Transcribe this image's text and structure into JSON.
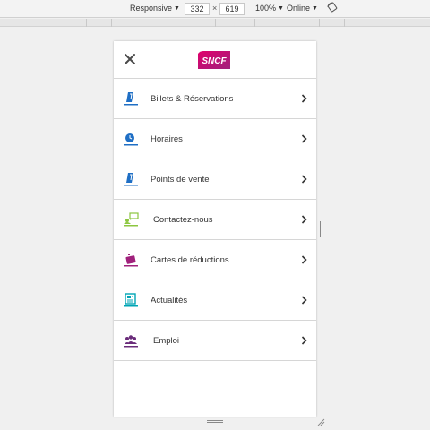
{
  "devtools": {
    "device_mode": "Responsive",
    "width": "332",
    "height": "619",
    "times": "×",
    "zoom": "100%",
    "network": "Online"
  },
  "header": {
    "logo_text": "SNCF",
    "brand_colors": [
      "#e0006c",
      "#a0217c"
    ]
  },
  "menu": {
    "items": [
      {
        "label": "Billets & Réservations",
        "icon": "ticket-icon",
        "color": "#1f6fc5"
      },
      {
        "label": "Horaires",
        "icon": "clock-icon",
        "color": "#1f6fc5"
      },
      {
        "label": "Points de vente",
        "icon": "ticket-icon",
        "color": "#1f6fc5"
      },
      {
        "label": "Contactez-nous",
        "icon": "chat-icon",
        "color": "#8cc63f"
      },
      {
        "label": "Cartes de réductions",
        "icon": "card-icon",
        "color": "#a0217c"
      },
      {
        "label": "Actualités",
        "icon": "news-icon",
        "color": "#00a5b5"
      },
      {
        "label": "Emploi",
        "icon": "people-icon",
        "color": "#6a2c7a"
      }
    ]
  }
}
